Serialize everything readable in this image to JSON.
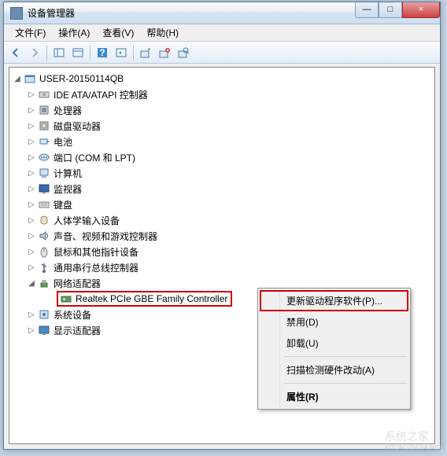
{
  "window": {
    "title": "设备管理器",
    "min": "—",
    "max": "□",
    "close": "×"
  },
  "menu": {
    "file": "文件(F)",
    "action": "操作(A)",
    "view": "查看(V)",
    "help": "帮助(H)"
  },
  "toolbar_icons": [
    "back-icon",
    "forward-icon",
    "up-icon",
    "properties-icon",
    "help-icon",
    "refresh-icon",
    "scan-icon",
    "update-icon",
    "uninstall-icon",
    "scan-hw-icon"
  ],
  "tree": {
    "root": "USER-20150114QB",
    "items": [
      {
        "label": "IDE ATA/ATAPI 控制器",
        "icon": "ide"
      },
      {
        "label": "处理器",
        "icon": "cpu"
      },
      {
        "label": "磁盘驱动器",
        "icon": "disk"
      },
      {
        "label": "电池",
        "icon": "battery"
      },
      {
        "label": "端口 (COM 和 LPT)",
        "icon": "port"
      },
      {
        "label": "计算机",
        "icon": "computer"
      },
      {
        "label": "监视器",
        "icon": "monitor"
      },
      {
        "label": "键盘",
        "icon": "keyboard"
      },
      {
        "label": "人体学输入设备",
        "icon": "hid"
      },
      {
        "label": "声音、视频和游戏控制器",
        "icon": "sound"
      },
      {
        "label": "鼠标和其他指针设备",
        "icon": "mouse"
      },
      {
        "label": "通用串行总线控制器",
        "icon": "usb"
      },
      {
        "label": "网络适配器",
        "icon": "network",
        "expanded": true,
        "children": [
          {
            "label": "Realtek PCIe GBE Family Controller",
            "icon": "nic",
            "selected": true
          }
        ]
      },
      {
        "label": "系统设备",
        "icon": "system"
      },
      {
        "label": "显示适配器",
        "icon": "display"
      }
    ]
  },
  "context_menu": {
    "update": "更新驱动程序软件(P)...",
    "disable": "禁用(D)",
    "uninstall": "卸载(U)",
    "scan": "扫描检测硬件改动(A)",
    "properties": "属性(R)"
  },
  "watermark": "系统之家",
  "watermark2": "XITONGZHIJIA.NET"
}
